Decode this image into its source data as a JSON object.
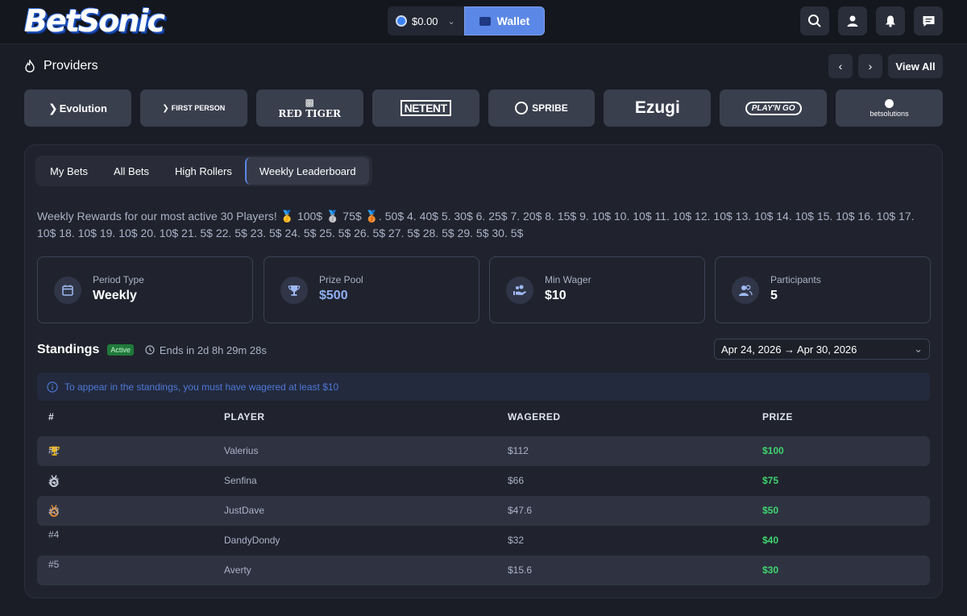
{
  "header": {
    "logo_text": "BetSonic",
    "balance": "$0.00",
    "wallet_label": "Wallet"
  },
  "providers": {
    "title": "Providers",
    "view_all": "View All",
    "items": [
      {
        "name": "Evolution",
        "icon": "evolution-logo"
      },
      {
        "name": "FIRST PERSON",
        "icon": "first-person-logo"
      },
      {
        "name": "RED TIGER",
        "icon": "red-tiger-logo"
      },
      {
        "name": "NETENT",
        "icon": "netent-logo"
      },
      {
        "name": "SPRIBE",
        "icon": "spribe-logo"
      },
      {
        "name": "Ezugi",
        "icon": "ezugi-logo"
      },
      {
        "name": "PLAY'N GO",
        "icon": "playngo-logo"
      },
      {
        "name": "betsolutions",
        "icon": "betsolutions-logo"
      }
    ]
  },
  "tabs": [
    {
      "label": "My Bets",
      "active": false
    },
    {
      "label": "All Bets",
      "active": false
    },
    {
      "label": "High Rollers",
      "active": false
    },
    {
      "label": "Weekly Leaderboard",
      "active": true
    }
  ],
  "rewards_text": "Weekly Rewards for our most active 30 Players! 🥇 100$ 🥈 75$ 🥉. 50$ 4. 40$ 5. 30$ 6. 25$ 7. 20$ 8. 15$ 9. 10$ 10. 10$ 11. 10$ 12. 10$ 13. 10$ 14. 10$ 15. 10$ 16. 10$ 17. 10$ 18. 10$ 19. 10$ 20. 10$ 21. 5$ 22. 5$ 23. 5$ 24. 5$ 25. 5$ 26. 5$ 27. 5$ 28. 5$ 29. 5$ 30. 5$",
  "stats": [
    {
      "label": "Period Type",
      "value": "Weekly",
      "icon": "calendar-icon",
      "value_color": "#ffffff"
    },
    {
      "label": "Prize Pool",
      "value": "$500",
      "icon": "trophy-icon",
      "value_color": "#8fb0f5"
    },
    {
      "label": "Min Wager",
      "value": "$10",
      "icon": "wager-hand-icon",
      "value_color": "#ffffff"
    },
    {
      "label": "Participants",
      "value": "5",
      "icon": "users-icon",
      "value_color": "#ffffff"
    }
  ],
  "standings": {
    "title": "Standings",
    "status": "Active",
    "ends_in": "Ends in 2d 8h 29m 28s",
    "date_range": "Apr 24, 2026 → Apr 30, 2026",
    "notice": "To appear in the standings, you must have wagered at least $10",
    "columns": [
      "#",
      "PLAYER",
      "WAGERED",
      "PRIZE"
    ],
    "rows": [
      {
        "rank": "#1",
        "player": "Valerius",
        "wagered": "$112",
        "prize": "$100",
        "icon": "trophy-gold-icon"
      },
      {
        "rank": "#2",
        "player": "Senfina",
        "wagered": "$66",
        "prize": "$75",
        "icon": "silver-medal-icon"
      },
      {
        "rank": "#3",
        "player": "JustDave",
        "wagered": "$47.6",
        "prize": "$50",
        "icon": "bronze-medal-icon"
      },
      {
        "rank": "#4",
        "player": "DandyDondy",
        "wagered": "$32",
        "prize": "$40",
        "icon": ""
      },
      {
        "rank": "#5",
        "player": "Averty",
        "wagered": "$15.6",
        "prize": "$30",
        "icon": ""
      }
    ]
  },
  "colors": {
    "accent": "#5b87e6",
    "prize_green": "#3fd46f",
    "active_badge": "#1f7a3a"
  }
}
